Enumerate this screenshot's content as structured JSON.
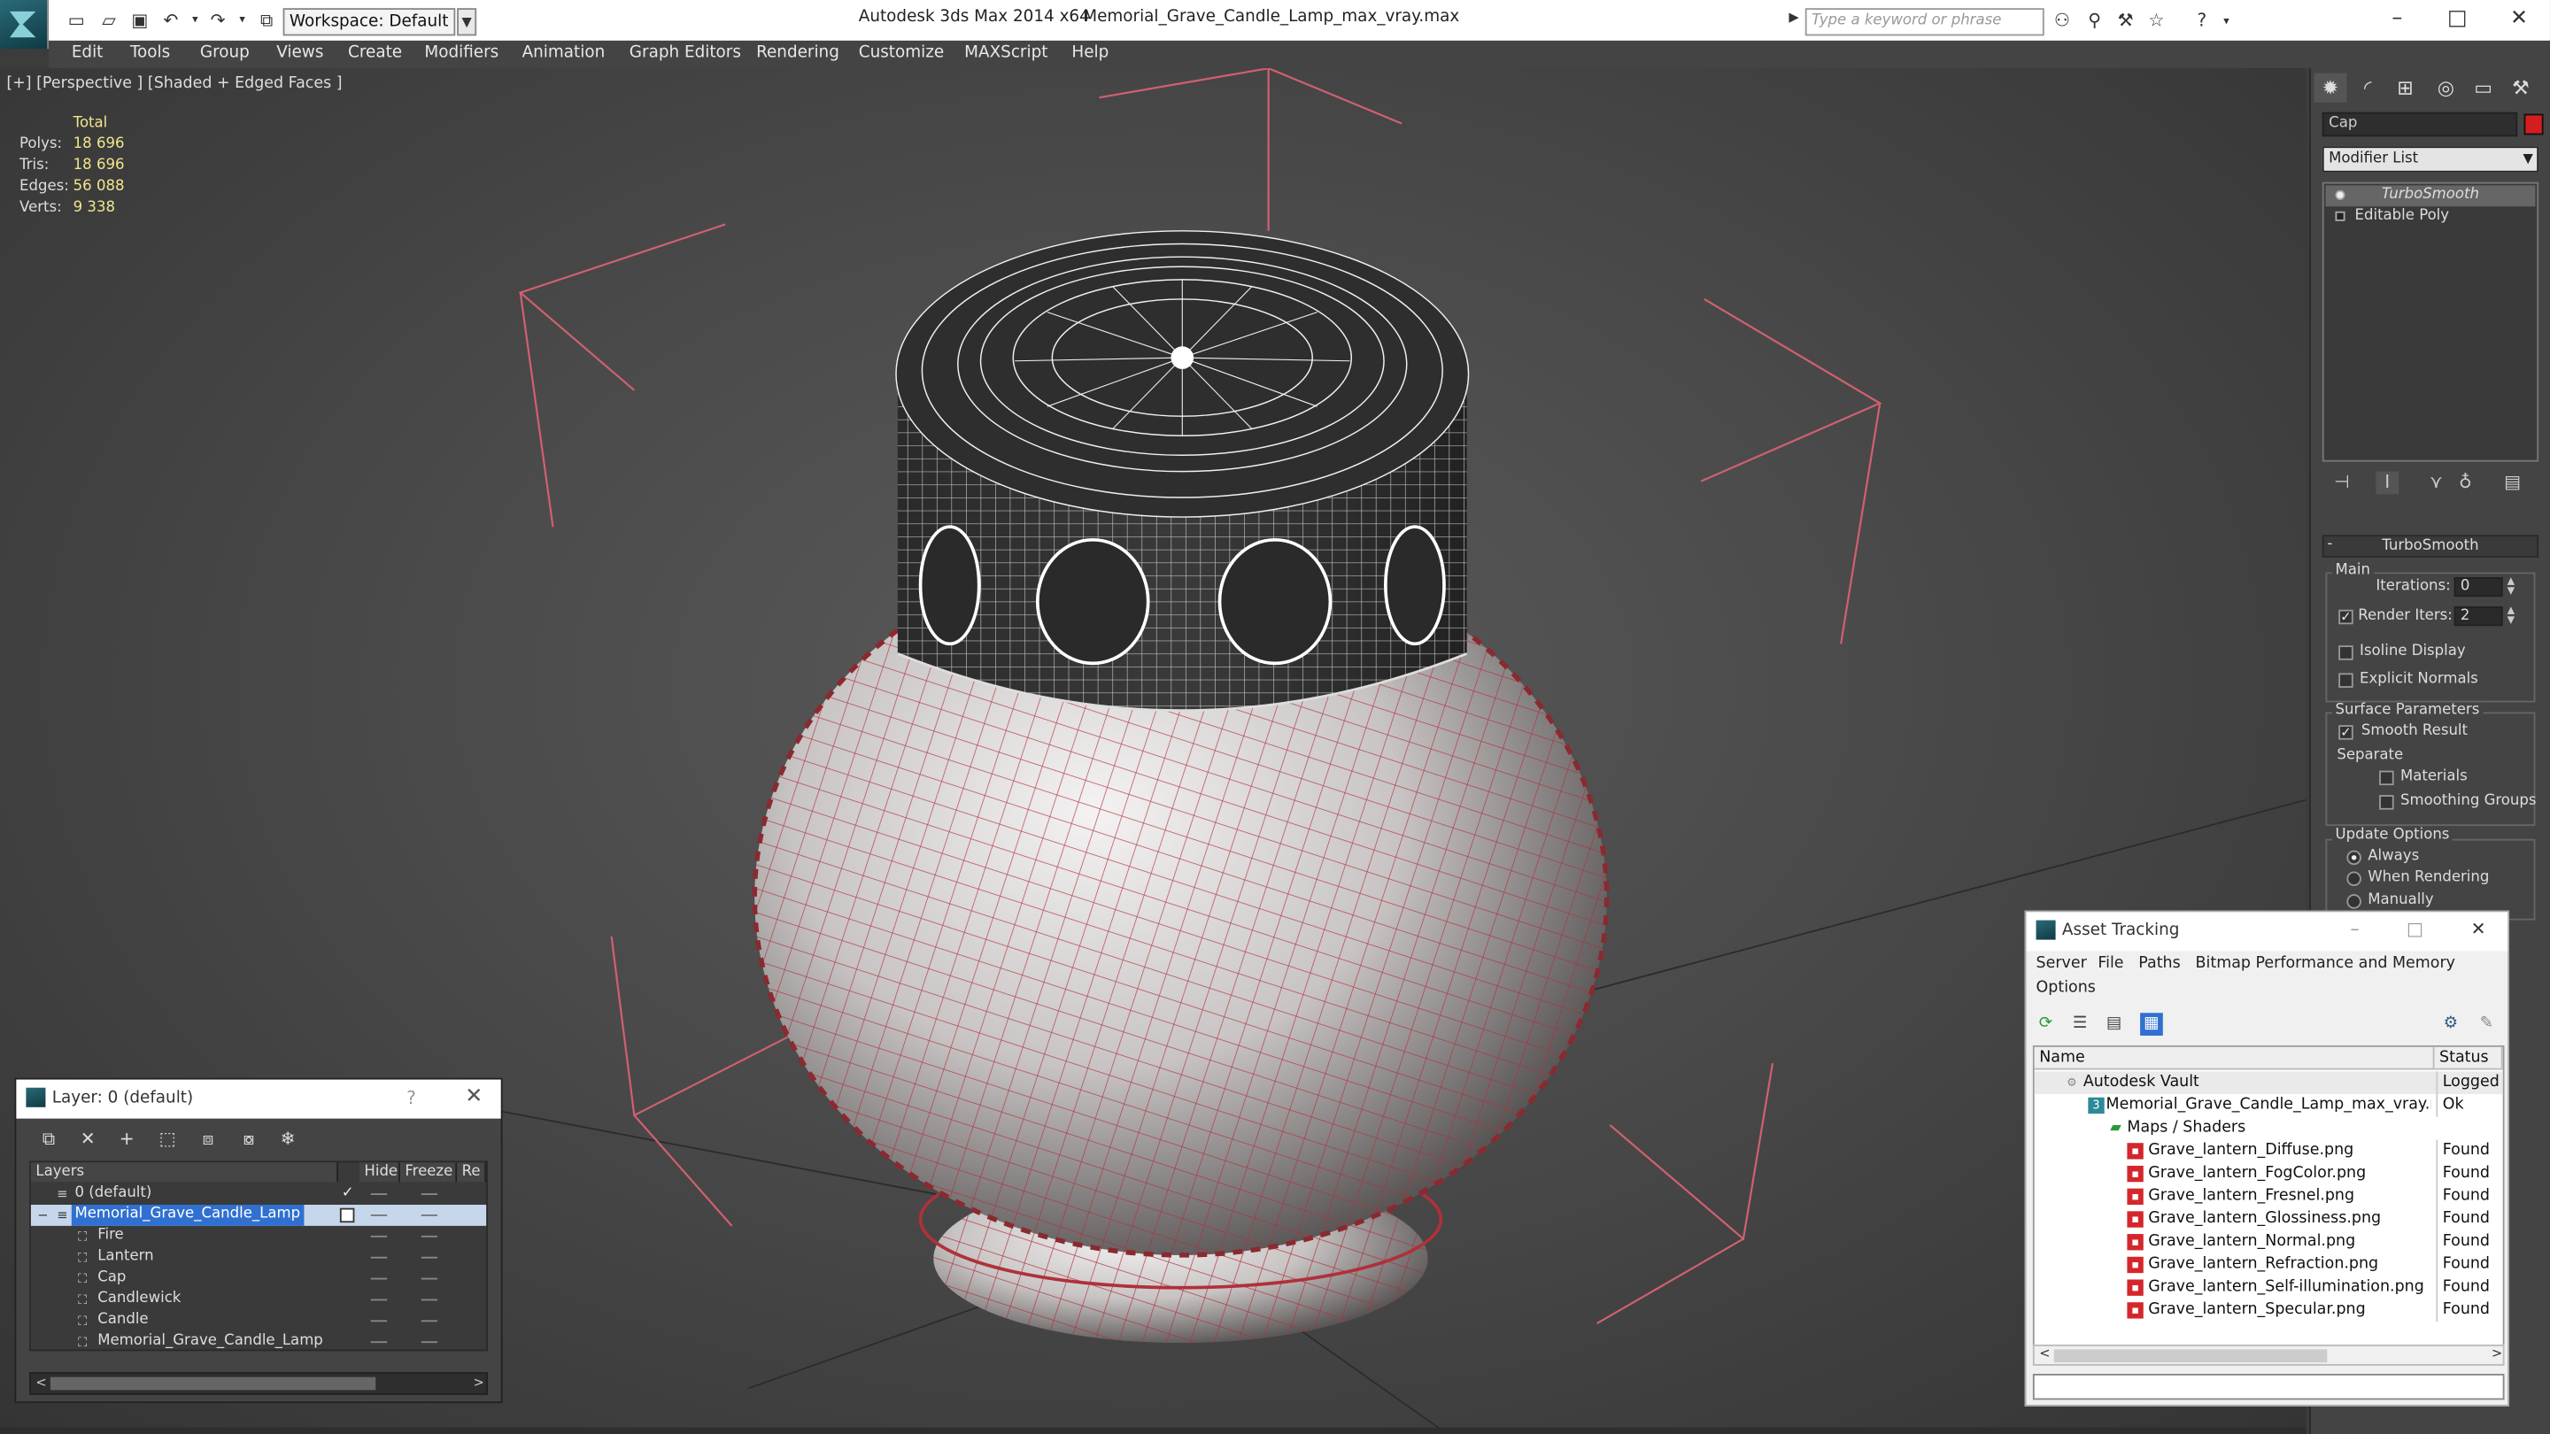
{
  "titlebar": {
    "workspace": "Workspace: Default",
    "app_title": "Autodesk 3ds Max  2014 x64",
    "file_title": "Memorial_Grave_Candle_Lamp_max_vray.max",
    "search_placeholder": "Type a keyword or phrase"
  },
  "menu": [
    "Edit",
    "Tools",
    "Group",
    "Views",
    "Create",
    "Modifiers",
    "Animation",
    "Graph Editors",
    "Rendering",
    "Customize",
    "MAXScript",
    "Help"
  ],
  "viewport": {
    "label": "[+] [Perspective ] [Shaded + Edged Faces ]",
    "stats_header": "Total",
    "stats": [
      {
        "label": "Polys:",
        "value": "18 696"
      },
      {
        "label": "Tris:",
        "value": "18 696"
      },
      {
        "label": "Edges:",
        "value": "56 088"
      },
      {
        "label": "Verts:",
        "value": "9 338"
      }
    ]
  },
  "command_panel": {
    "object_name": "Cap",
    "object_color": "#d21e1e",
    "modifier_list": "Modifier List",
    "stack": [
      "TurboSmooth",
      "Editable Poly"
    ],
    "rollout_title": "TurboSmooth",
    "main_label": "Main",
    "iterations_label": "Iterations:",
    "iterations_value": "0",
    "render_iters_label": "Render Iters:",
    "render_iters_value": "2",
    "isoline": "Isoline Display",
    "explicit_normals": "Explicit Normals",
    "surface_params": "Surface Parameters",
    "smooth_result": "Smooth Result",
    "separate": "Separate",
    "materials": "Materials",
    "smoothing_groups": "Smoothing Groups",
    "update_options": "Update Options",
    "always": "Always",
    "when_rendering": "When Rendering",
    "manually": "Manually"
  },
  "layer_panel": {
    "title": "Layer: 0 (default)",
    "help": "?",
    "columns": [
      "Layers",
      "Hide",
      "Freeze",
      "Re"
    ],
    "rows": [
      {
        "name": "0 (default)",
        "indent": 0
      },
      {
        "name": "Memorial_Grave_Candle_Lamp",
        "indent": 0
      },
      {
        "name": "Fire",
        "indent": 1
      },
      {
        "name": "Lantern",
        "indent": 1
      },
      {
        "name": "Cap",
        "indent": 1
      },
      {
        "name": "Candlewick",
        "indent": 1
      },
      {
        "name": "Candle",
        "indent": 1
      },
      {
        "name": "Memorial_Grave_Candle_Lamp",
        "indent": 1
      }
    ]
  },
  "asset_tracking": {
    "title": "Asset Tracking",
    "menu": [
      "Server",
      "File",
      "Paths",
      "Bitmap Performance and Memory",
      "Options"
    ],
    "columns": [
      "Name",
      "Status"
    ],
    "rows": [
      {
        "name": "Autodesk Vault",
        "status": "Logged O",
        "level": 0
      },
      {
        "name": "Memorial_Grave_Candle_Lamp_max_vray.max",
        "status": "Ok",
        "level": 1
      },
      {
        "name": "Maps / Shaders",
        "status": "",
        "level": 2
      },
      {
        "name": "Grave_lantern_Diffuse.png",
        "status": "Found",
        "level": 3
      },
      {
        "name": "Grave_lantern_FogColor.png",
        "status": "Found",
        "level": 3
      },
      {
        "name": "Grave_lantern_Fresnel.png",
        "status": "Found",
        "level": 3
      },
      {
        "name": "Grave_lantern_Glossiness.png",
        "status": "Found",
        "level": 3
      },
      {
        "name": "Grave_lantern_Normal.png",
        "status": "Found",
        "level": 3
      },
      {
        "name": "Grave_lantern_Refraction.png",
        "status": "Found",
        "level": 3
      },
      {
        "name": "Grave_lantern_Self-illumination.png",
        "status": "Found",
        "level": 3
      },
      {
        "name": "Grave_lantern_Specular.png",
        "status": "Found",
        "level": 3
      }
    ]
  }
}
